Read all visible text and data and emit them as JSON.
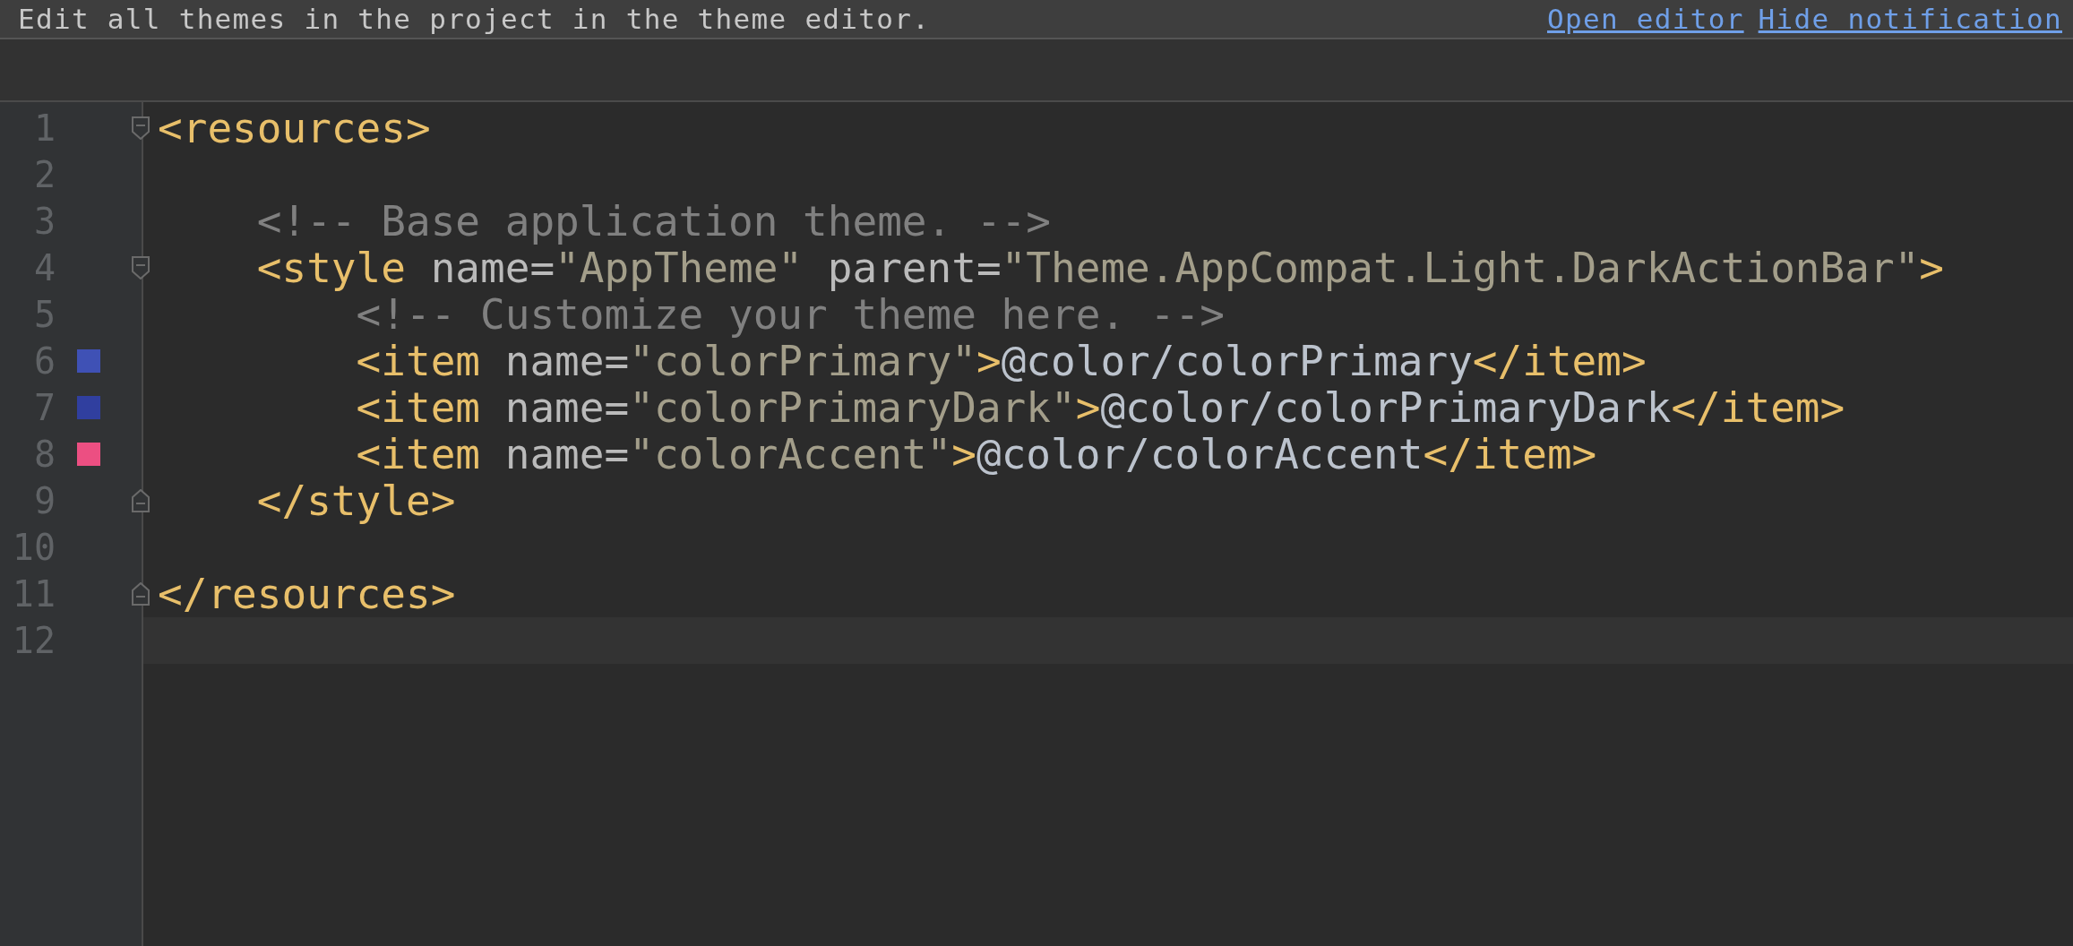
{
  "notification": {
    "text": "Edit all themes in the project in the theme editor.",
    "links": [
      "Open editor",
      "Hide notification"
    ]
  },
  "lines": [
    {
      "number": "1",
      "fold_start": true,
      "tokens": [
        {
          "kind": "tag",
          "text": "<resources>"
        }
      ]
    },
    {
      "number": "2"
    },
    {
      "number": "3",
      "tokens": [
        {
          "kind": "comment",
          "text": "    <!-- Base application theme. -->"
        }
      ]
    },
    {
      "number": "4",
      "fold_start": true,
      "tokens": [
        {
          "kind": "tag",
          "text": "    <style"
        },
        {
          "kind": "attr",
          "text": " name="
        },
        {
          "kind": "value",
          "text": "\"AppTheme\""
        },
        {
          "kind": "attr",
          "text": " parent="
        },
        {
          "kind": "value",
          "text": "\"Theme.AppCompat.Light.DarkActionBar\""
        },
        {
          "kind": "tag",
          "text": ">"
        }
      ]
    },
    {
      "number": "5",
      "tokens": [
        {
          "kind": "comment",
          "text": "        <!-- Customize your theme here. -->"
        }
      ]
    },
    {
      "number": "6",
      "color": "#3f51b5",
      "tokens": [
        {
          "kind": "tag",
          "text": "        <item"
        },
        {
          "kind": "attr",
          "text": " name="
        },
        {
          "kind": "value",
          "text": "\"colorPrimary\""
        },
        {
          "kind": "tag",
          "text": ">"
        },
        {
          "kind": "text",
          "text": "@color/colorPrimary"
        },
        {
          "kind": "tag",
          "text": "</item>"
        }
      ]
    },
    {
      "number": "7",
      "color": "#303f9f",
      "tokens": [
        {
          "kind": "tag",
          "text": "        <item"
        },
        {
          "kind": "attr",
          "text": " name="
        },
        {
          "kind": "value",
          "text": "\"colorPrimaryDark\""
        },
        {
          "kind": "tag",
          "text": ">"
        },
        {
          "kind": "text",
          "text": "@color/colorPrimaryDark"
        },
        {
          "kind": "tag",
          "text": "</item>"
        }
      ]
    },
    {
      "number": "8",
      "color": "#ec4f82",
      "tokens": [
        {
          "kind": "tag",
          "text": "        <item"
        },
        {
          "kind": "attr",
          "text": " name="
        },
        {
          "kind": "value",
          "text": "\"colorAccent\""
        },
        {
          "kind": "tag",
          "text": ">"
        },
        {
          "kind": "text",
          "text": "@color/colorAccent"
        },
        {
          "kind": "tag",
          "text": "</item>"
        }
      ]
    },
    {
      "number": "9",
      "fold_end": true,
      "tokens": [
        {
          "kind": "tag",
          "text": "    </style>"
        }
      ]
    },
    {
      "number": "10"
    },
    {
      "number": "11",
      "fold_end": true,
      "tokens": [
        {
          "kind": "tag",
          "text": "</resources>"
        }
      ]
    },
    {
      "number": "12",
      "current": true
    }
  ]
}
